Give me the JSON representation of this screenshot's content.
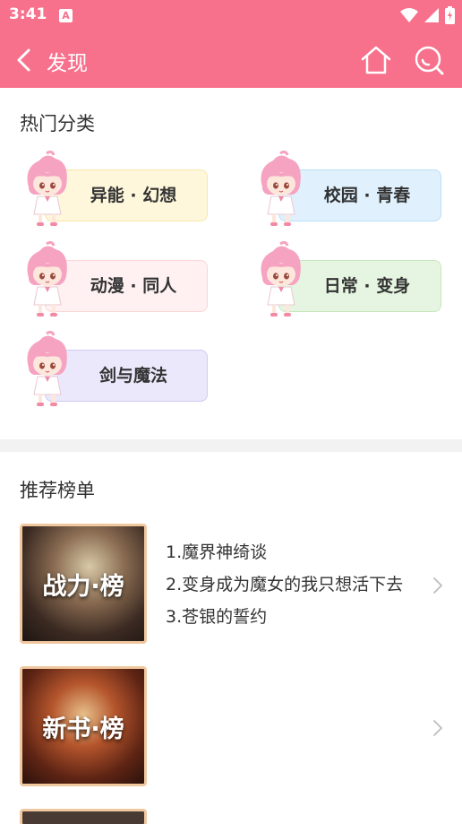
{
  "status": {
    "time": "3:41",
    "notif_icon": "A"
  },
  "appbar": {
    "title": "发现"
  },
  "hot": {
    "title": "热门分类",
    "items": [
      {
        "label": "异能 · 幻想",
        "bg": "#fff7dc",
        "border": "#f6e7a8"
      },
      {
        "label": "校园 · 青春",
        "bg": "#e0f1fd",
        "border": "#b9def8"
      },
      {
        "label": "动漫 · 同人",
        "bg": "#fff1f1",
        "border": "#fbd6d6"
      },
      {
        "label": "日常 · 变身",
        "bg": "#e6f5e1",
        "border": "#c7e7bd"
      },
      {
        "label": "剑与魔法",
        "bg": "#ebe8fb",
        "border": "#cfc9f2"
      }
    ]
  },
  "rec": {
    "title": "推荐榜单",
    "lists": [
      {
        "cover_label": "战力·榜",
        "books": [
          "1.魔界神绮谈",
          "2.变身成为魔女的我只想活下去",
          "3.苍银的誓约"
        ]
      },
      {
        "cover_label": "新书·榜",
        "books": []
      }
    ]
  }
}
